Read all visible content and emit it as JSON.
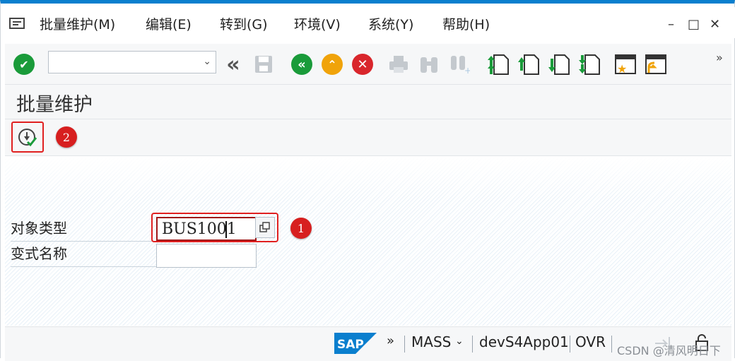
{
  "menu": {
    "items": [
      "批量维护(M)",
      "编辑(E)",
      "转到(G)",
      "环境(V)",
      "系统(Y)",
      "帮助(H)"
    ]
  },
  "window_controls": {
    "minimize": "–",
    "maximize": "□",
    "close": "✕"
  },
  "toolbar": {
    "command_value": "",
    "more": "»",
    "buttons": [
      "enter-icon",
      "back-history-icon",
      "save-icon",
      "back-icon",
      "exit-icon",
      "cancel-icon",
      "print-icon",
      "find-icon",
      "find-next-icon",
      "first-page-icon",
      "previous-page-icon",
      "next-page-icon",
      "last-page-icon",
      "create-session-icon",
      "create-shortcut-icon"
    ]
  },
  "page": {
    "title": "批量维护"
  },
  "app_toolbar": {
    "execute_icon": "execute-icon",
    "badge": "2"
  },
  "form": {
    "object_type_label": "对象类型",
    "object_type_value": "BUS1001",
    "variant_label": "变式名称",
    "variant_value": "",
    "badge": "1"
  },
  "status": {
    "more": "»",
    "transaction": "MASS",
    "server": "devS4App01",
    "mode": "OVR"
  },
  "watermark": "CSDN @清风明日下",
  "colors": {
    "accent": "#0a7fce",
    "highlight": "#e02020",
    "green": "#1a9b3a",
    "orange": "#f0a30a",
    "red": "#d9262c"
  }
}
